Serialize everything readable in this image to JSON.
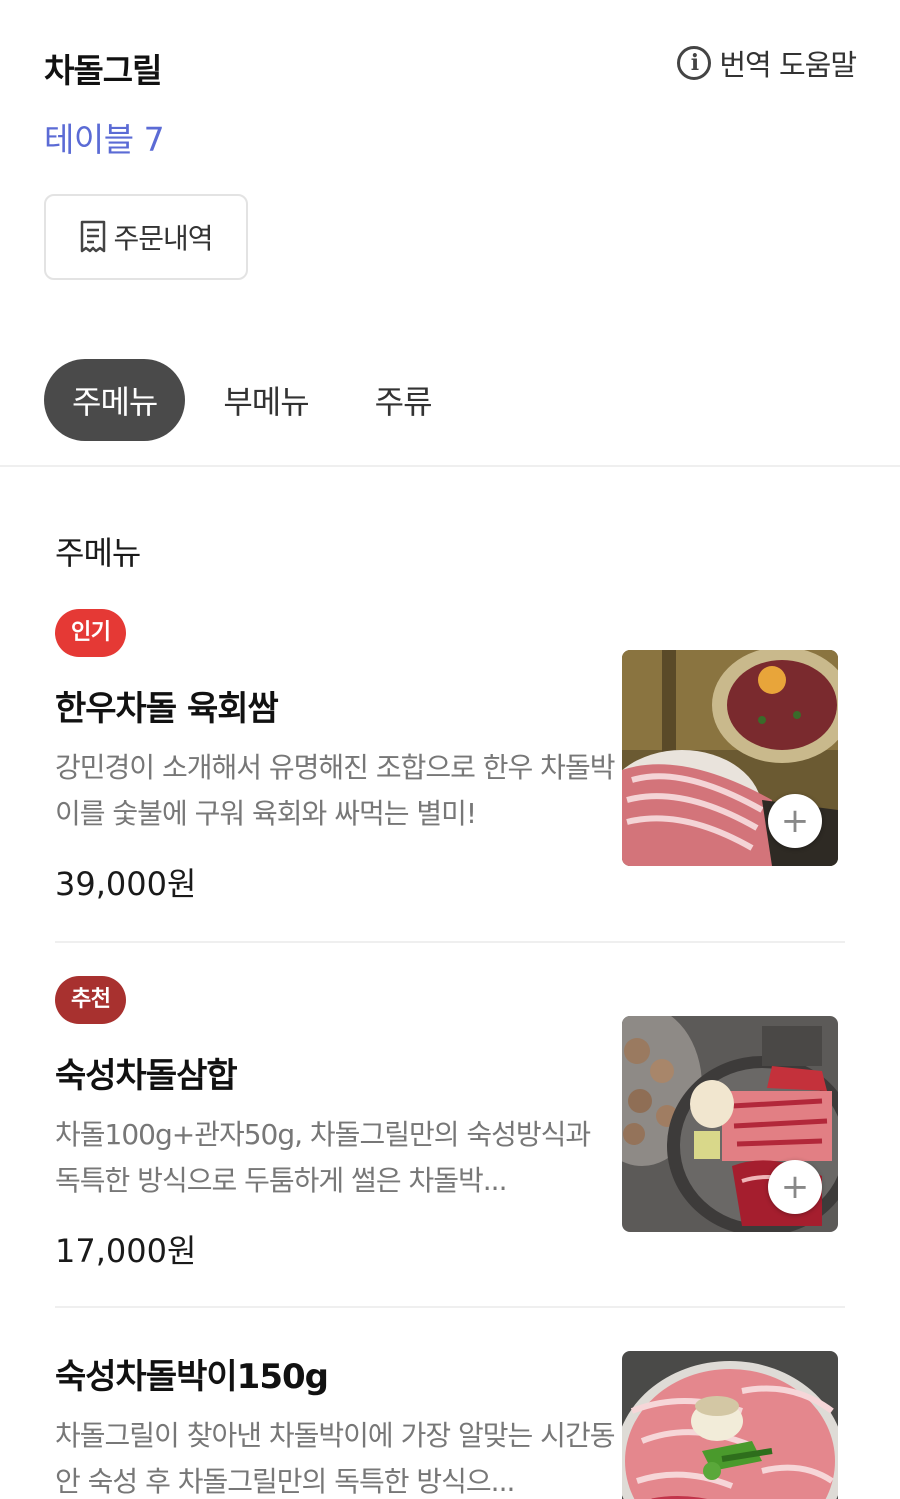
{
  "header": {
    "store_name": "차돌그릴",
    "table_name": "테이블 7",
    "help_label": "번역 도움말",
    "order_history_label": "주문내역"
  },
  "tabs": [
    {
      "label": "주메뉴",
      "active": true
    },
    {
      "label": "부메뉴",
      "active": false
    },
    {
      "label": "주류",
      "active": false
    }
  ],
  "section": {
    "title": "주메뉴"
  },
  "items": [
    {
      "badge": "인기",
      "badge_color": "#e53935",
      "name": "한우차돌 육회쌈",
      "description": "강민경이 소개해서 유명해진 조합으로 한우 차돌박이를 숯불에 구워 육회와 싸먹는 별미!",
      "price": "39,000원",
      "image_icon": "beef-yukhoe-photo"
    },
    {
      "badge": "추천",
      "badge_color": "#a8312f",
      "name": "숙성차돌삼합",
      "description": "차돌100g+관자50g, 차돌그릴만의 숙성방식과 독특한 방식으로 두툼하게 썰은 차돌박...",
      "price": "17,000원",
      "image_icon": "beef-scallop-photo"
    },
    {
      "badge": "",
      "badge_color": "",
      "name": "숙성차돌박이150g",
      "description": "차돌그릴이 찾아낸 차돌박이에 가장 알맞는 시간동안 숙성 후 차돌그릴만의 독특한 방식으...",
      "price": "",
      "image_icon": "sliced-brisket-photo"
    }
  ],
  "icons": {
    "info": "info-icon",
    "receipt": "receipt-icon",
    "add": "plus-icon"
  }
}
